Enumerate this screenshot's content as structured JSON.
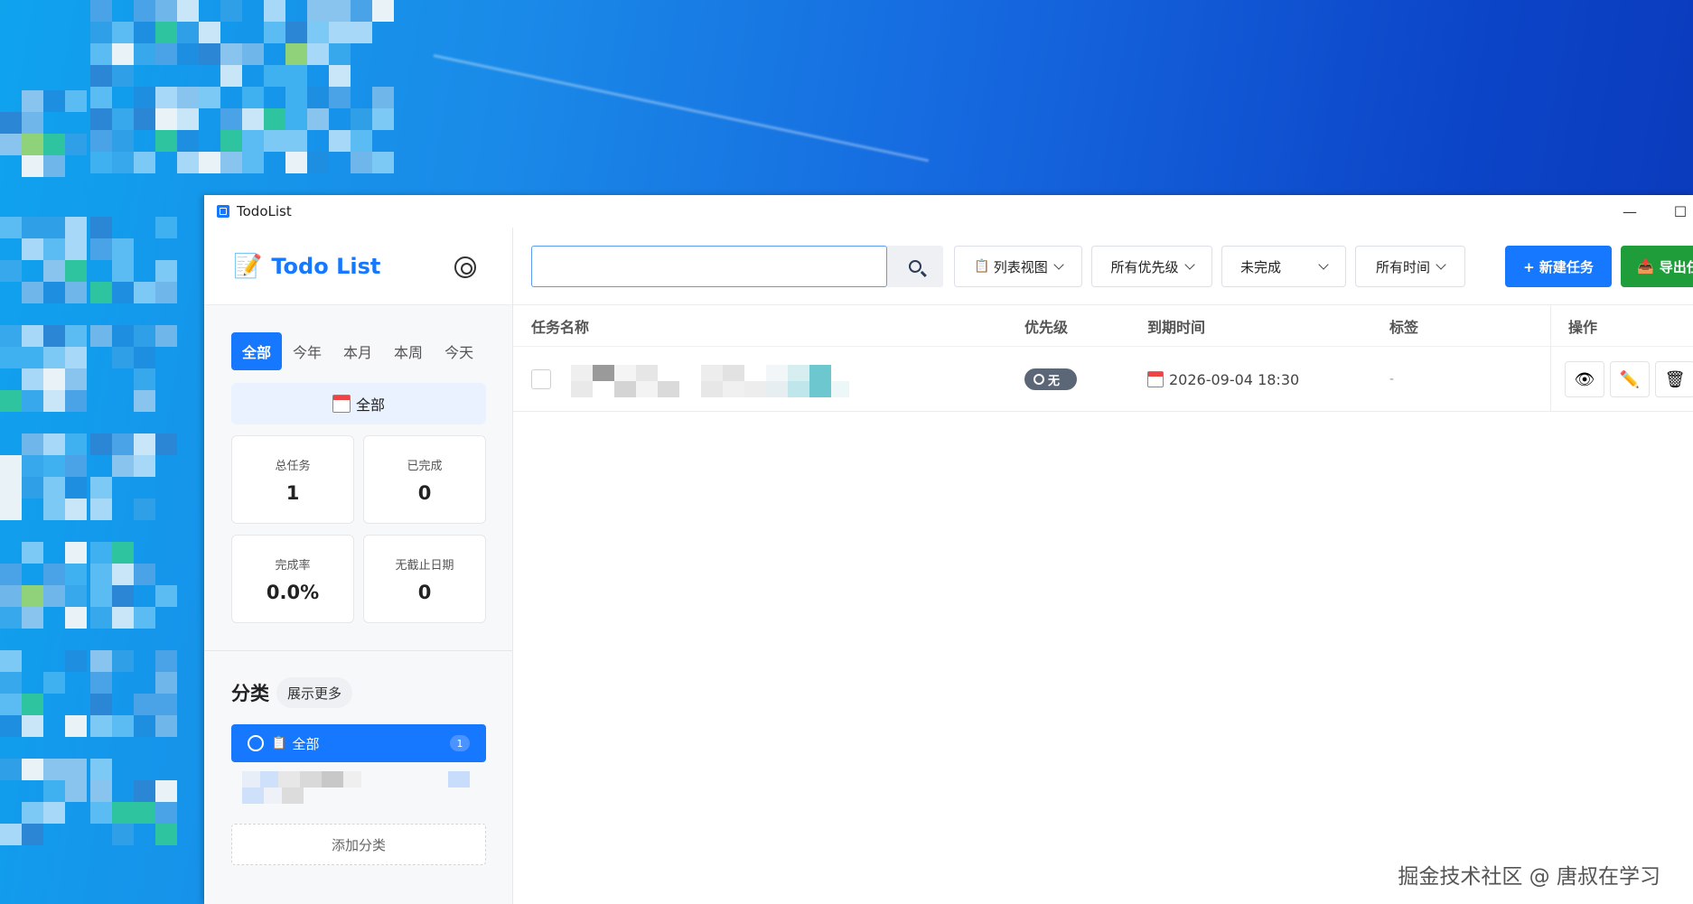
{
  "window": {
    "title": "TodoList",
    "minimize_glyph": "—",
    "maximize_glyph": "☐"
  },
  "sidebar": {
    "brand_icon": "memo-icon",
    "brand_title": "Todo List",
    "range_tabs": [
      {
        "label": "全部",
        "active": true
      },
      {
        "label": "今年",
        "active": false
      },
      {
        "label": "本月",
        "active": false
      },
      {
        "label": "本周",
        "active": false
      },
      {
        "label": "今天",
        "active": false
      }
    ],
    "all_button": "全部",
    "stats": [
      {
        "label": "总任务",
        "value": "1"
      },
      {
        "label": "已完成",
        "value": "0"
      },
      {
        "label": "完成率",
        "value": "0.0%"
      },
      {
        "label": "无截止日期",
        "value": "0"
      }
    ],
    "category_title": "分类",
    "show_more": "展示更多",
    "categories": [
      {
        "label": "全部",
        "count": "1",
        "selected": true
      }
    ],
    "add_category": "添加分类"
  },
  "toolbar": {
    "search_placeholder": "",
    "view_mode": "列表视图",
    "priority_filter": "所有优先级",
    "status_filter": "未完成",
    "time_filter": "所有时间",
    "new_task": "+ 新建任务",
    "export": "导出任务"
  },
  "table": {
    "columns": [
      "任务名称",
      "优先级",
      "到期时间",
      "标签",
      "操作"
    ],
    "rows": [
      {
        "name": "",
        "priority": "无",
        "due": "2026-09-04 18:30",
        "tags": "-"
      }
    ]
  },
  "watermark": "掘金技术社区 @ 唐叔在学习",
  "colors": {
    "accent": "#1677ff",
    "export_green": "#1f9d3a",
    "priority_none": "#5b6677"
  }
}
